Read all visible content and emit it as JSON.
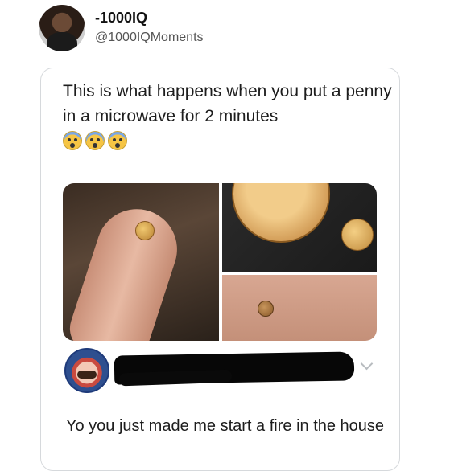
{
  "author": {
    "display_name": "-1000IQ",
    "handle": "@1000IQMoments"
  },
  "post": {
    "text": "This is what happens when you put a penny in a microwave for 2 minutes",
    "emojis": [
      "screaming-face",
      "screaming-face",
      "screaming-face"
    ]
  },
  "media": {
    "photos": [
      "penny-on-finger",
      "penny-size-comparison",
      "penny-on-palm"
    ]
  },
  "reply": {
    "text": "Yo you just made me start a fire in the house"
  },
  "colors": {
    "card_border": "#d6d9dc",
    "handle_text": "#555555",
    "redaction": "#070707"
  }
}
